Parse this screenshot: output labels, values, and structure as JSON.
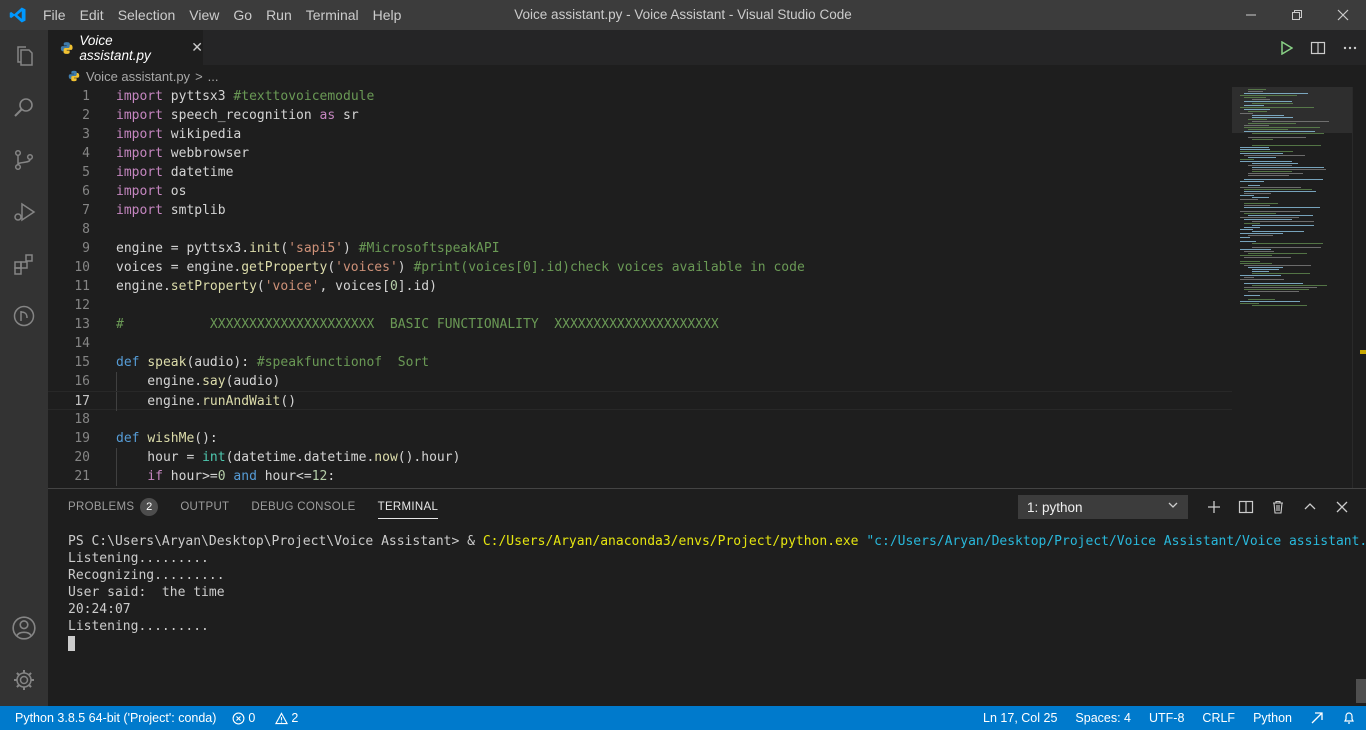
{
  "window": {
    "title": "Voice assistant.py - Voice Assistant - Visual Studio Code",
    "menu": [
      "File",
      "Edit",
      "Selection",
      "View",
      "Go",
      "Run",
      "Terminal",
      "Help"
    ]
  },
  "tab": {
    "label": "Voice assistant.py"
  },
  "breadcrumb": {
    "file": "Voice assistant.py",
    "sep": ">",
    "more": "..."
  },
  "code": {
    "lines": [
      {
        "n": "1"
      },
      {
        "n": "2"
      },
      {
        "n": "3"
      },
      {
        "n": "4"
      },
      {
        "n": "5"
      },
      {
        "n": "6"
      },
      {
        "n": "7"
      },
      {
        "n": "8"
      },
      {
        "n": "9"
      },
      {
        "n": "10"
      },
      {
        "n": "11"
      },
      {
        "n": "12"
      },
      {
        "n": "13"
      },
      {
        "n": "14"
      },
      {
        "n": "15"
      },
      {
        "n": "16"
      },
      {
        "n": "17"
      },
      {
        "n": "18"
      },
      {
        "n": "19"
      },
      {
        "n": "20"
      },
      {
        "n": "21"
      }
    ],
    "t": {
      "import": "import",
      "as": "as",
      "def": "def",
      "and": "and",
      "if": "if",
      "m1": " pyttsx3 ",
      "c1": "#texttovoicemodule",
      "m2": " speech_recognition ",
      "m2b": " sr",
      "m3": " wikipedia",
      "m4": " webbrowser",
      "m5": " datetime",
      "m6": " os",
      "m7": " smtplib",
      "l9a": "engine = pyttsx3.",
      "l9b": "init",
      "l9c": "(",
      "l9d": "'sapi5'",
      "l9e": ") ",
      "l9f": "#MicrosoftspeakAPI",
      "l10a": "voices = engine.",
      "l10b": "getProperty",
      "l10c": "(",
      "l10d": "'voices'",
      "l10e": ") ",
      "l10f": "#print(voices[0].id)check voices available in code",
      "l11a": "engine.",
      "l11b": "setProperty",
      "l11c": "(",
      "l11d": "'voice'",
      "l11e": ", voices[",
      "l11f": "0",
      "l11g": "].id)",
      "l13": "#           XXXXXXXXXXXXXXXXXXXXX  BASIC FUNCTIONALITY  XXXXXXXXXXXXXXXXXXXXX",
      "l15a": " ",
      "l15b": "speak",
      "l15c": "(audio): ",
      "l15d": "#speakfunctionof  Sort",
      "l16a": "    engine.",
      "l16b": "say",
      "l16c": "(audio)",
      "l17a": "    engine.",
      "l17b": "runAndWait",
      "l17c": "()",
      "l19a": " ",
      "l19b": "wishMe",
      "l19c": "():",
      "l20a": "    hour = ",
      "l20b": "int",
      "l20c": "(datetime.datetime.",
      "l20d": "now",
      "l20e": "().hour)",
      "l21a": "    ",
      "l21b": " hour>=",
      "l21c": "0",
      "l21d": " ",
      "l21e": " hour<=",
      "l21f": "12",
      ":": ":"
    }
  },
  "panel": {
    "tabs": {
      "problems": "PROBLEMS",
      "problems_count": "2",
      "output": "OUTPUT",
      "debug": "DEBUG CONSOLE",
      "terminal": "TERMINAL"
    },
    "terminal_select": "1: python",
    "terminal_lines": {
      "prompt": "PS C:\\Users\\Aryan\\Desktop\\Project\\Voice Assistant> & ",
      "exe": "C:/Users/Aryan/anaconda3/envs/Project/python.exe",
      "script": " \"c:/Users/Aryan/Desktop/Project/Voice Assistant/Voice assistant.py\"",
      "o1": "Listening.........",
      "o2": "Recognizing.........",
      "o3": "User said:  the time",
      "o4": "20:24:07",
      "o5": "Listening........."
    }
  },
  "status": {
    "interpreter": "Python 3.8.5 64-bit ('Project': conda)",
    "errors": "0",
    "warnings": "2",
    "position": "Ln 17, Col 25",
    "spaces": "Spaces: 4",
    "encoding": "UTF-8",
    "eol": "CRLF",
    "language": "Python"
  },
  "colors": {
    "statusbar": "#007acc",
    "activitybar": "#333333",
    "titlebar": "#3c3c3c",
    "editor": "#1e1e1e"
  }
}
